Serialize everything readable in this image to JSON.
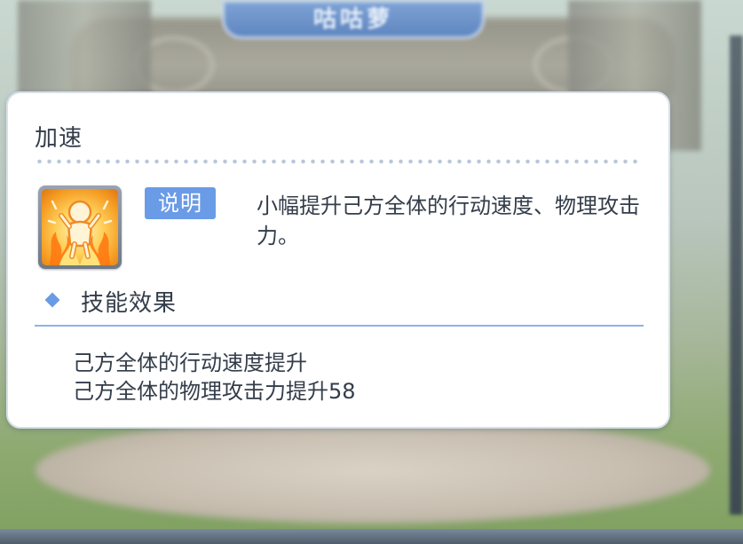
{
  "background": {
    "title": "咕咕萝"
  },
  "dialog": {
    "title": "加速",
    "skill_icon": "power-up-figure-icon",
    "badge_label": "说明",
    "description": "小幅提升己方全体的行动速度、物理攻击力。",
    "section_title": "技能效果",
    "effects": [
      "己方全体的行动速度提升",
      "己方全体的物理攻击力提升58"
    ]
  },
  "colors": {
    "accent": "#6a9be6",
    "text": "#333d4a",
    "divider": "#8fb2e6"
  }
}
